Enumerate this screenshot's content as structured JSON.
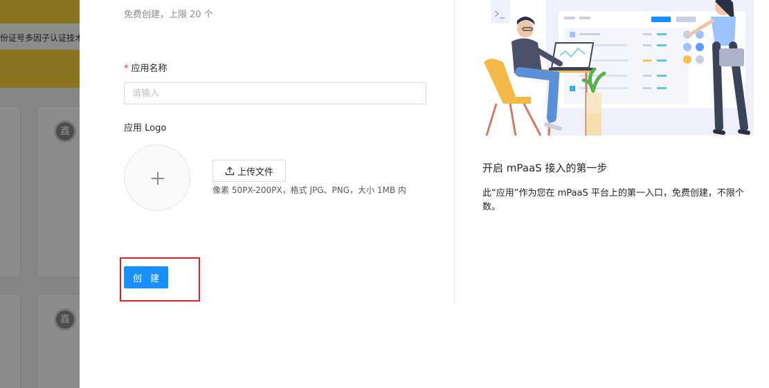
{
  "background": {
    "banner_text": "身份证号多因子认证技术",
    "card_avatar_char": "鑫"
  },
  "form": {
    "subtitle": "免费创建，上限 20 个",
    "name": {
      "required_mark": "*",
      "label": "应用名称",
      "placeholder": "请输入",
      "value": ""
    },
    "logo": {
      "label": "应用 Logo",
      "upload_button": "上传文件",
      "hint": "像素 50PX-200PX，格式 JPG、PNG，大小 1MB 内"
    },
    "create_button": "创 建"
  },
  "info": {
    "title": "开启 mPaaS 接入的第一步",
    "description": "此“应用”作为您在 mPaaS 平台上的第一入口，免费创建，不限个数。"
  },
  "icons": {
    "plus": "plus-icon",
    "upload": "upload-icon"
  },
  "colors": {
    "primary": "#1890ff",
    "required": "#f5222d",
    "highlight": "#e02020",
    "banner": "#fbd43e"
  }
}
